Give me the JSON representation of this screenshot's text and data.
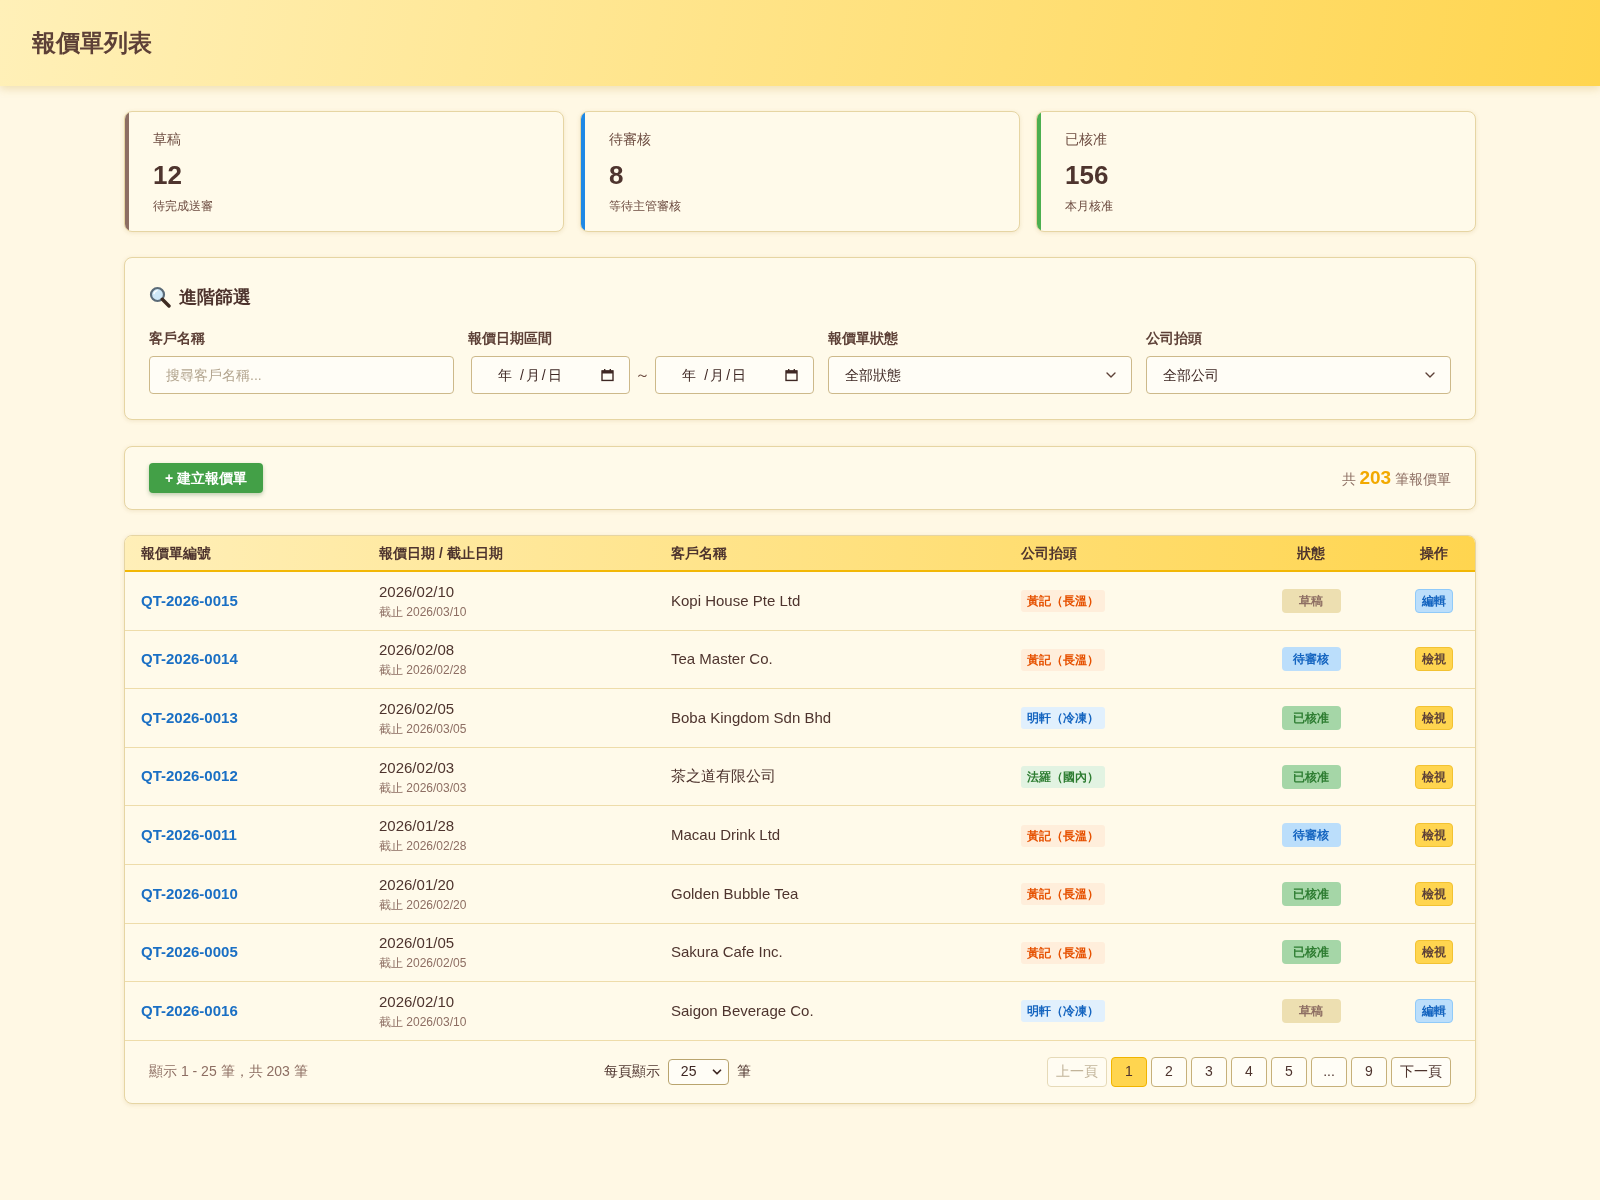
{
  "header": {
    "title": "報價單列表"
  },
  "stats": [
    {
      "label": "草稿",
      "value": "12",
      "note": "待完成送審",
      "color": "#8d6e63"
    },
    {
      "label": "待審核",
      "value": "8",
      "note": "等待主管審核",
      "color": "#1e88e5"
    },
    {
      "label": "已核准",
      "value": "156",
      "note": "本月核准",
      "color": "#4caf50"
    }
  ],
  "filters": {
    "title": "進階篩選",
    "fields": [
      {
        "kind": "text",
        "label": "客戶名稱",
        "placeholder": "搜尋客戶名稱..."
      },
      {
        "kind": "date_range",
        "label": "報價日期區間",
        "from": {
          "placeholder": "年 /月/日"
        },
        "separator": "～",
        "to": {
          "placeholder": "年 /月/日"
        }
      },
      {
        "kind": "select",
        "label": "報價單狀態",
        "value": "全部狀態"
      },
      {
        "kind": "select",
        "label": "公司抬頭",
        "value": "全部公司"
      }
    ]
  },
  "toolbar": {
    "create_button": "+ 建立報價單",
    "total": "共 **203** 筆報價單"
  },
  "table": {
    "columns": [
      "報價單編號",
      "報價日期 / 截止日期",
      "客戶名稱",
      "公司抬頭",
      "狀態",
      "操作"
    ],
    "rows": [
      {
        "id": "QT-2026-0015",
        "date": "2026/02/10",
        "deadline": "截止 2026/03/10",
        "customer": "Kopi House Pte Ltd",
        "company": {
          "label": "黃記（長溫）",
          "color": "#e65100"
        },
        "status": {
          "label": "草稿",
          "color": "#eddfb1"
        },
        "action": {
          "label": "編輯",
          "kind": "edit"
        }
      },
      {
        "id": "QT-2026-0014",
        "date": "2026/02/08",
        "deadline": "截止 2026/02/28",
        "customer": "Tea Master Co.",
        "company": {
          "label": "黃記（長溫）",
          "color": "#e65100"
        },
        "status": {
          "label": "待審核",
          "color": "#bbdefb"
        },
        "action": {
          "label": "檢視",
          "kind": "view"
        }
      },
      {
        "id": "QT-2026-0013",
        "date": "2026/02/05",
        "deadline": "截止 2026/03/05",
        "customer": "Boba Kingdom Sdn Bhd",
        "company": {
          "label": "明軒（冷凍）",
          "color": "#1565c0"
        },
        "status": {
          "label": "已核准",
          "color": "#a5d6a7"
        },
        "action": {
          "label": "檢視",
          "kind": "view"
        }
      },
      {
        "id": "QT-2026-0012",
        "date": "2026/02/03",
        "deadline": "截止 2026/03/03",
        "customer": "茶之道有限公司",
        "company": {
          "label": "法羅（國內）",
          "color": "#2e7d32"
        },
        "status": {
          "label": "已核准",
          "color": "#a5d6a7"
        },
        "action": {
          "label": "檢視",
          "kind": "view"
        }
      },
      {
        "id": "QT-2026-0011",
        "date": "2026/01/28",
        "deadline": "截止 2026/02/28",
        "customer": "Macau Drink Ltd",
        "company": {
          "label": "黃記（長溫）",
          "color": "#e65100"
        },
        "status": {
          "label": "待審核",
          "color": "#bbdefb"
        },
        "action": {
          "label": "檢視",
          "kind": "view"
        }
      },
      {
        "id": "QT-2026-0010",
        "date": "2026/01/20",
        "deadline": "截止 2026/02/20",
        "customer": "Golden Bubble Tea",
        "company": {
          "label": "黃記（長溫）",
          "color": "#e65100"
        },
        "status": {
          "label": "已核准",
          "color": "#a5d6a7"
        },
        "action": {
          "label": "檢視",
          "kind": "view"
        }
      },
      {
        "id": "QT-2026-0005",
        "date": "2026/01/05",
        "deadline": "截止 2026/02/05",
        "customer": "Sakura Cafe Inc.",
        "company": {
          "label": "黃記（長溫）",
          "color": "#e65100"
        },
        "status": {
          "label": "已核准",
          "color": "#a5d6a7"
        },
        "action": {
          "label": "檢視",
          "kind": "view"
        }
      },
      {
        "id": "QT-2026-0016",
        "date": "2026/02/10",
        "deadline": "截止 2026/03/10",
        "customer": "Saigon Beverage Co.",
        "company": {
          "label": "明軒（冷凍）",
          "color": "#1565c0"
        },
        "status": {
          "label": "草稿",
          "color": "#eddfb1"
        },
        "action": {
          "label": "編輯",
          "kind": "edit"
        }
      }
    ]
  },
  "pagination": {
    "summary": "顯示 1 - 25 筆，共 203 筆",
    "per_page_label": "每頁顯示",
    "per_page": "25",
    "per_page_unit": "筆",
    "prev": {
      "label": "上一頁",
      "disabled": true
    },
    "pages": [
      {
        "label": "1",
        "selected": true
      },
      {
        "label": "2",
        "selected": false
      },
      {
        "label": "3",
        "selected": false
      },
      {
        "label": "4",
        "selected": false
      },
      {
        "label": "5",
        "selected": false
      },
      {
        "label": "...",
        "selected": false
      },
      {
        "label": "9",
        "selected": false
      }
    ],
    "next": {
      "label": "下一頁",
      "disabled": false
    }
  }
}
